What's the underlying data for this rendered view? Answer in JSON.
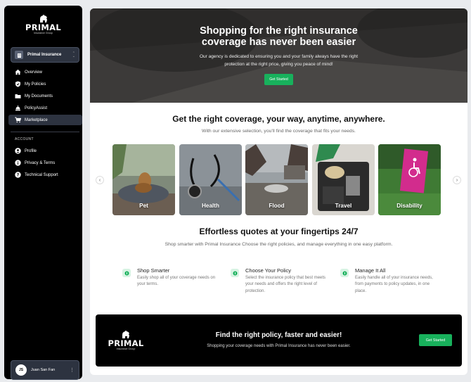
{
  "brand": {
    "name": "PRIMAL",
    "subtitle": "Insurance Group"
  },
  "org_selector": {
    "avatar": "PI",
    "name": "Primal Insurance"
  },
  "nav": [
    {
      "label": "Overview",
      "icon": "home-icon"
    },
    {
      "label": "My Policies",
      "icon": "shield-icon"
    },
    {
      "label": "My Documents",
      "icon": "folder-icon"
    },
    {
      "label": "PolicyAssist",
      "icon": "assist-icon"
    },
    {
      "label": "Marketplace",
      "icon": "cart-icon",
      "active": true
    }
  ],
  "account": {
    "heading": "ACCOUNT",
    "items": [
      {
        "label": "Profile",
        "icon": "user-icon"
      },
      {
        "label": "Privacy & Terms",
        "icon": "info-icon"
      },
      {
        "label": "Technical Support",
        "icon": "help-icon"
      }
    ]
  },
  "user": {
    "initials": "JS",
    "name": "Juan San Fan"
  },
  "hero": {
    "title_line1": "Shopping for the right insurance",
    "title_line2": "coverage has never been easier",
    "text_line1": "Our agency is dedicated to ensuring you and your family always have the right",
    "text_line2": "protection at the right price, giving you peace of mind!",
    "button": "Get Started"
  },
  "coverage": {
    "title": "Get the right coverage, your way, anytime, anywhere.",
    "subtitle": "With our extensive selection, you'll find the coverage that fits your needs.",
    "cards": [
      {
        "label": "Pet"
      },
      {
        "label": "Health"
      },
      {
        "label": "Flood"
      },
      {
        "label": "Travel"
      },
      {
        "label": "Disability"
      }
    ]
  },
  "quotes": {
    "title": "Effortless quotes at your fingertips 24/7",
    "subtitle": "Shop smarter with Primal Insurance Choose the right policies, and manage everything in one easy platform.",
    "features": [
      {
        "title": "Shop Smarter",
        "text": "Easily shop all of your coverage needs on your terms."
      },
      {
        "title": "Choose Your Policy",
        "text": "Select the insurance policy that best meets your needs and offers the right level of protection."
      },
      {
        "title": "Manage It All",
        "text": "Easily handle all of your insurance needs, from payments to policy updates, in one place."
      }
    ]
  },
  "cta": {
    "title": "Find the right policy, faster and easier!",
    "subtitle": "Shopping your coverage needs with Primal Insurance has never been easier.",
    "button": "Get Started"
  },
  "colors": {
    "accent": "#18b15c",
    "sidebar": "#000000",
    "active_nav": "#2d3340"
  }
}
